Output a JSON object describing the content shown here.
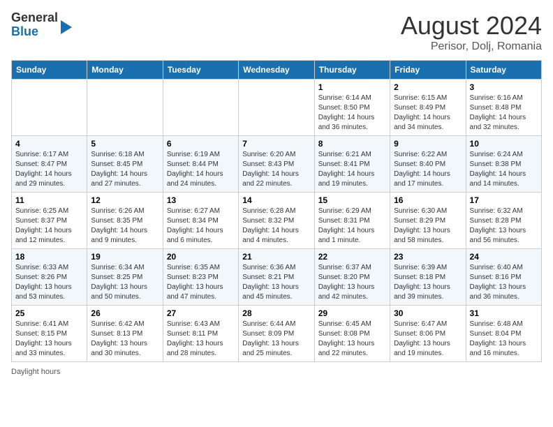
{
  "header": {
    "logo": {
      "line1": "General",
      "line2": "Blue"
    },
    "title": "August 2024",
    "location": "Perisor, Dolj, Romania"
  },
  "calendar": {
    "days_of_week": [
      "Sunday",
      "Monday",
      "Tuesday",
      "Wednesday",
      "Thursday",
      "Friday",
      "Saturday"
    ],
    "weeks": [
      [
        {
          "day": "",
          "info": ""
        },
        {
          "day": "",
          "info": ""
        },
        {
          "day": "",
          "info": ""
        },
        {
          "day": "",
          "info": ""
        },
        {
          "day": "1",
          "info": "Sunrise: 6:14 AM\nSunset: 8:50 PM\nDaylight: 14 hours and 36 minutes."
        },
        {
          "day": "2",
          "info": "Sunrise: 6:15 AM\nSunset: 8:49 PM\nDaylight: 14 hours and 34 minutes."
        },
        {
          "day": "3",
          "info": "Sunrise: 6:16 AM\nSunset: 8:48 PM\nDaylight: 14 hours and 32 minutes."
        }
      ],
      [
        {
          "day": "4",
          "info": "Sunrise: 6:17 AM\nSunset: 8:47 PM\nDaylight: 14 hours and 29 minutes."
        },
        {
          "day": "5",
          "info": "Sunrise: 6:18 AM\nSunset: 8:45 PM\nDaylight: 14 hours and 27 minutes."
        },
        {
          "day": "6",
          "info": "Sunrise: 6:19 AM\nSunset: 8:44 PM\nDaylight: 14 hours and 24 minutes."
        },
        {
          "day": "7",
          "info": "Sunrise: 6:20 AM\nSunset: 8:43 PM\nDaylight: 14 hours and 22 minutes."
        },
        {
          "day": "8",
          "info": "Sunrise: 6:21 AM\nSunset: 8:41 PM\nDaylight: 14 hours and 19 minutes."
        },
        {
          "day": "9",
          "info": "Sunrise: 6:22 AM\nSunset: 8:40 PM\nDaylight: 14 hours and 17 minutes."
        },
        {
          "day": "10",
          "info": "Sunrise: 6:24 AM\nSunset: 8:38 PM\nDaylight: 14 hours and 14 minutes."
        }
      ],
      [
        {
          "day": "11",
          "info": "Sunrise: 6:25 AM\nSunset: 8:37 PM\nDaylight: 14 hours and 12 minutes."
        },
        {
          "day": "12",
          "info": "Sunrise: 6:26 AM\nSunset: 8:35 PM\nDaylight: 14 hours and 9 minutes."
        },
        {
          "day": "13",
          "info": "Sunrise: 6:27 AM\nSunset: 8:34 PM\nDaylight: 14 hours and 6 minutes."
        },
        {
          "day": "14",
          "info": "Sunrise: 6:28 AM\nSunset: 8:32 PM\nDaylight: 14 hours and 4 minutes."
        },
        {
          "day": "15",
          "info": "Sunrise: 6:29 AM\nSunset: 8:31 PM\nDaylight: 14 hours and 1 minute."
        },
        {
          "day": "16",
          "info": "Sunrise: 6:30 AM\nSunset: 8:29 PM\nDaylight: 13 hours and 58 minutes."
        },
        {
          "day": "17",
          "info": "Sunrise: 6:32 AM\nSunset: 8:28 PM\nDaylight: 13 hours and 56 minutes."
        }
      ],
      [
        {
          "day": "18",
          "info": "Sunrise: 6:33 AM\nSunset: 8:26 PM\nDaylight: 13 hours and 53 minutes."
        },
        {
          "day": "19",
          "info": "Sunrise: 6:34 AM\nSunset: 8:25 PM\nDaylight: 13 hours and 50 minutes."
        },
        {
          "day": "20",
          "info": "Sunrise: 6:35 AM\nSunset: 8:23 PM\nDaylight: 13 hours and 47 minutes."
        },
        {
          "day": "21",
          "info": "Sunrise: 6:36 AM\nSunset: 8:21 PM\nDaylight: 13 hours and 45 minutes."
        },
        {
          "day": "22",
          "info": "Sunrise: 6:37 AM\nSunset: 8:20 PM\nDaylight: 13 hours and 42 minutes."
        },
        {
          "day": "23",
          "info": "Sunrise: 6:39 AM\nSunset: 8:18 PM\nDaylight: 13 hours and 39 minutes."
        },
        {
          "day": "24",
          "info": "Sunrise: 6:40 AM\nSunset: 8:16 PM\nDaylight: 13 hours and 36 minutes."
        }
      ],
      [
        {
          "day": "25",
          "info": "Sunrise: 6:41 AM\nSunset: 8:15 PM\nDaylight: 13 hours and 33 minutes."
        },
        {
          "day": "26",
          "info": "Sunrise: 6:42 AM\nSunset: 8:13 PM\nDaylight: 13 hours and 30 minutes."
        },
        {
          "day": "27",
          "info": "Sunrise: 6:43 AM\nSunset: 8:11 PM\nDaylight: 13 hours and 28 minutes."
        },
        {
          "day": "28",
          "info": "Sunrise: 6:44 AM\nSunset: 8:09 PM\nDaylight: 13 hours and 25 minutes."
        },
        {
          "day": "29",
          "info": "Sunrise: 6:45 AM\nSunset: 8:08 PM\nDaylight: 13 hours and 22 minutes."
        },
        {
          "day": "30",
          "info": "Sunrise: 6:47 AM\nSunset: 8:06 PM\nDaylight: 13 hours and 19 minutes."
        },
        {
          "day": "31",
          "info": "Sunrise: 6:48 AM\nSunset: 8:04 PM\nDaylight: 13 hours and 16 minutes."
        }
      ]
    ]
  },
  "footer": {
    "note": "Daylight hours"
  }
}
